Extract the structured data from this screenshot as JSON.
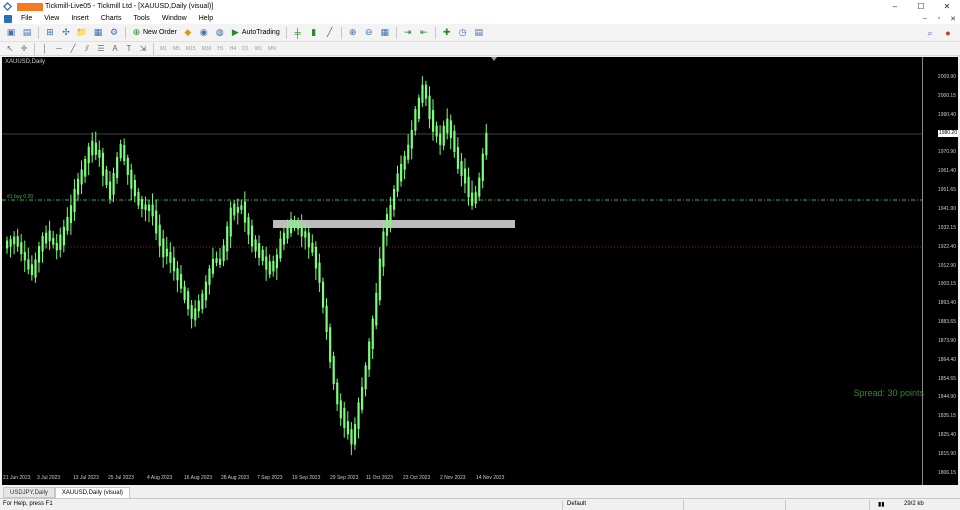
{
  "window": {
    "title": "Tickmill-Live05 - Tickmill Ltd - [XAUUSD,Daily (visual)]",
    "controls": [
      "–",
      "☐",
      "✕"
    ]
  },
  "menu": {
    "items": [
      "File",
      "View",
      "Insert",
      "Charts",
      "Tools",
      "Window",
      "Help"
    ],
    "mdi": [
      "–",
      "▫",
      "✕"
    ]
  },
  "toolbar": {
    "new_order_label": "New Order",
    "auto_trading_label": "AutoTrading",
    "timeframes": [
      "M1",
      "M5",
      "M15",
      "M30",
      "H1",
      "H4",
      "D1",
      "W1",
      "MN"
    ]
  },
  "chart": {
    "title": "XAUUSD,Daily",
    "spread_label": "Spread: 30 points",
    "order_label": "#1 buy 0.20",
    "current_price": "1980.20",
    "price_levels": [
      "2009.90",
      "2000.15",
      "1990.40",
      "1980.20",
      "1970.90",
      "1961.40",
      "1951.65",
      "1941.90",
      "1932.15",
      "1922.40",
      "1912.90",
      "1903.15",
      "1893.40",
      "1883.65",
      "1873.90",
      "1864.40",
      "1854.65",
      "1844.90",
      "1835.15",
      "1825.40",
      "1815.90",
      "1806.15"
    ],
    "date_labels": [
      "21 Jun 2023",
      "3 Jul 2023",
      "13 Jul 2023",
      "25 Jul 2023",
      "4 Aug 2023",
      "16 Aug 2023",
      "28 Aug 2023",
      "7 Sep 2023",
      "19 Sep 2023",
      "29 Sep 2023",
      "11 Oct 2023",
      "23 Oct 2023",
      "2 Nov 2023",
      "14 Nov 2023"
    ],
    "candle_color": "#7CFC7C",
    "background": "#000000",
    "order_line_color": "#39b54a",
    "sl_line_color": "#8b1a1a",
    "zone_color": "#bdbdbd"
  },
  "tabs": [
    {
      "label": "USDJPY,Daily",
      "active": false
    },
    {
      "label": "XAUUSD,Daily (visual)",
      "active": true
    }
  ],
  "status": {
    "help": "For Help, press F1",
    "profile": "Default",
    "traffic": "29/2 kb"
  }
}
